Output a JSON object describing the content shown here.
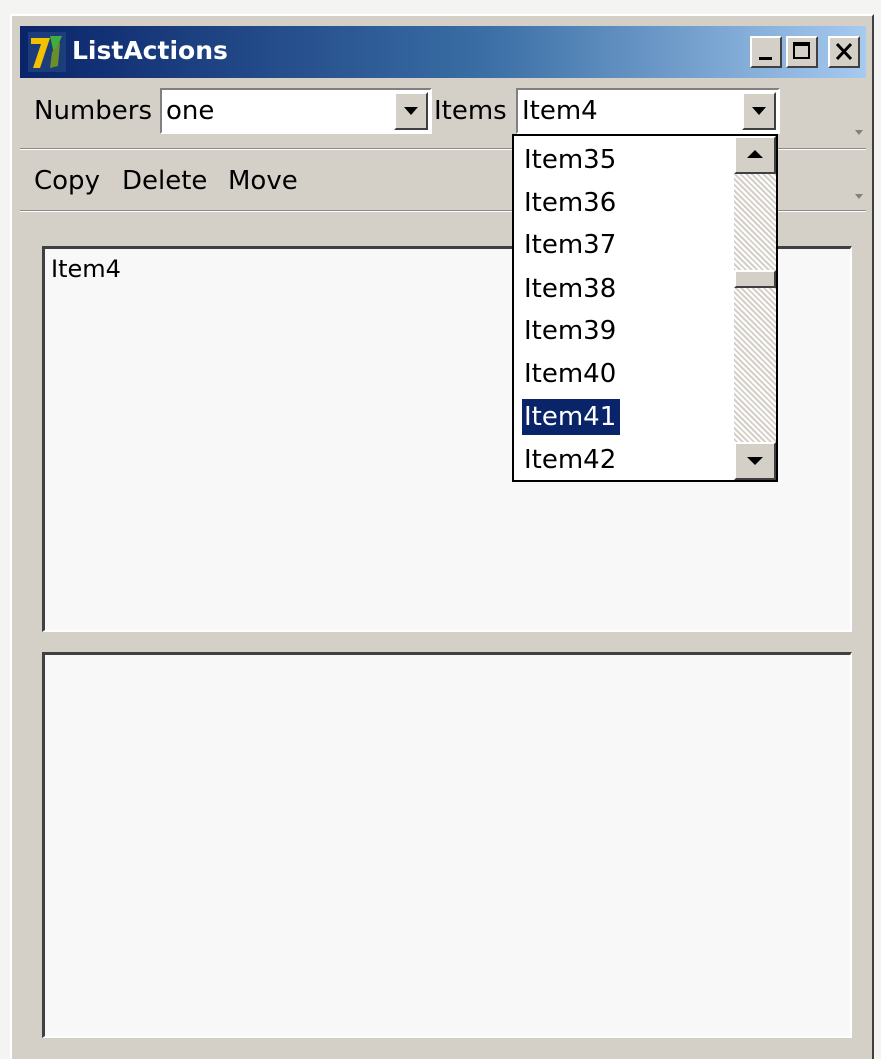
{
  "window": {
    "title": "ListActions"
  },
  "toolbar": {
    "numbers_label": "Numbers",
    "numbers_value": "one",
    "items_label": "Items",
    "items_value": "Item4"
  },
  "menu": {
    "copy": "Copy",
    "delete": "Delete",
    "move": "Move"
  },
  "items_dropdown": {
    "options": [
      "Item35",
      "Item36",
      "Item37",
      "Item38",
      "Item39",
      "Item40",
      "Item41",
      "Item42"
    ],
    "selected": "Item41"
  },
  "top_list": {
    "items": [
      "Item4"
    ]
  },
  "bottom_list": {
    "items": []
  },
  "colors": {
    "titlebar_start": "#0a246a",
    "titlebar_end": "#a6caf0",
    "selection": "#0a246a",
    "face": "#d4d0c8"
  }
}
